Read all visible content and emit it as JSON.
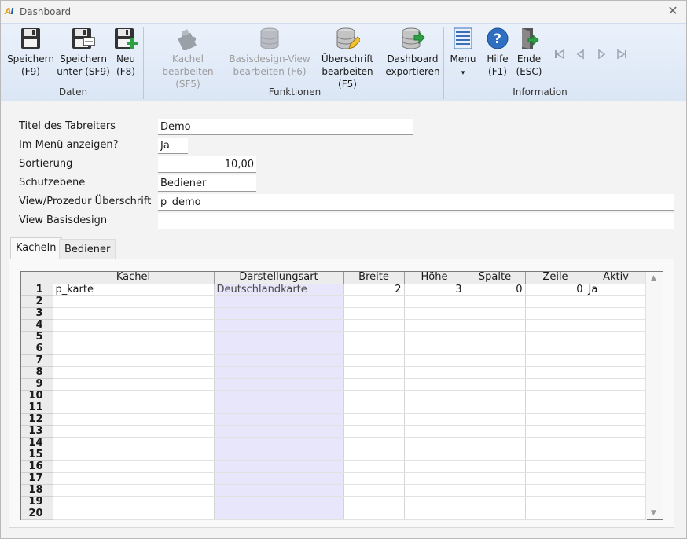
{
  "window": {
    "title": "Dashboard",
    "logo_a": "A",
    "logo_i": "I"
  },
  "ribbon": {
    "groups": [
      {
        "label": "Daten"
      },
      {
        "label": "Funktionen"
      },
      {
        "label": "Information"
      }
    ],
    "buttons": {
      "save": {
        "line1": "Speichern",
        "line2": "(F9)",
        "icon": "floppy-disk-icon"
      },
      "save_as": {
        "line1": "Speichern",
        "line2": "unter (SF9)",
        "icon": "floppy-save-as-icon"
      },
      "new": {
        "line1": "Neu",
        "line2": "(F8)",
        "icon": "floppy-new-icon"
      },
      "edit_tile": {
        "line1": "Kachel",
        "line2": "bearbeiten (SF5)",
        "icon": "puzzle-icon"
      },
      "edit_base_view": {
        "line1": "Basisdesign-View",
        "line2": "bearbeiten (F6)",
        "icon": "database-icon"
      },
      "edit_heading": {
        "line1": "Überschrift",
        "line2": "bearbeiten (F5)",
        "icon": "database-edit-icon"
      },
      "export_dashboard": {
        "line1": "Dashboard",
        "line2": "exportieren",
        "icon": "database-export-icon"
      },
      "menu": {
        "line1": "Menu",
        "line2": "▾",
        "icon": "menu-icon"
      },
      "help": {
        "line1": "Hilfe",
        "line2": "(F1)",
        "icon": "help-icon"
      },
      "exit": {
        "line1": "Ende",
        "line2": "(ESC)",
        "icon": "exit-door-icon"
      }
    },
    "nav_icons": [
      "first-record-icon",
      "previous-record-icon",
      "next-record-icon",
      "last-record-icon"
    ]
  },
  "form": {
    "tab_title": {
      "label": "Titel des Tabreiters",
      "value": "Demo"
    },
    "show_in_menu": {
      "label": "Im Menü anzeigen?",
      "value": "Ja"
    },
    "sort": {
      "label": "Sortierung",
      "value": "10,00"
    },
    "protection": {
      "label": "Schutzebene",
      "value": "Bediener"
    },
    "view_heading": {
      "label": "View/Prozedur Überschrift",
      "value": "p_demo"
    },
    "view_base": {
      "label": "View Basisdesign",
      "value": ""
    }
  },
  "tabs": [
    {
      "label": "Kacheln",
      "active": true
    },
    {
      "label": "Bediener",
      "active": false
    }
  ],
  "grid": {
    "columns": [
      "Kachel",
      "Darstellungsart",
      "Breite",
      "Höhe",
      "Spalte",
      "Zeile",
      "Aktiv"
    ],
    "rows": [
      [
        "1",
        "p_karte",
        "Deutschlandkarte",
        "2",
        "3",
        "0",
        "0",
        "Ja"
      ],
      [
        "2",
        "",
        "",
        "",
        "",
        "",
        "",
        ""
      ],
      [
        "3",
        "",
        "",
        "",
        "",
        "",
        "",
        ""
      ],
      [
        "4",
        "",
        "",
        "",
        "",
        "",
        "",
        ""
      ],
      [
        "5",
        "",
        "",
        "",
        "",
        "",
        "",
        ""
      ],
      [
        "6",
        "",
        "",
        "",
        "",
        "",
        "",
        ""
      ],
      [
        "7",
        "",
        "",
        "",
        "",
        "",
        "",
        ""
      ],
      [
        "8",
        "",
        "",
        "",
        "",
        "",
        "",
        ""
      ],
      [
        "9",
        "",
        "",
        "",
        "",
        "",
        "",
        ""
      ],
      [
        "10",
        "",
        "",
        "",
        "",
        "",
        "",
        ""
      ],
      [
        "11",
        "",
        "",
        "",
        "",
        "",
        "",
        ""
      ],
      [
        "12",
        "",
        "",
        "",
        "",
        "",
        "",
        ""
      ],
      [
        "13",
        "",
        "",
        "",
        "",
        "",
        "",
        ""
      ],
      [
        "14",
        "",
        "",
        "",
        "",
        "",
        "",
        ""
      ],
      [
        "15",
        "",
        "",
        "",
        "",
        "",
        "",
        ""
      ],
      [
        "16",
        "",
        "",
        "",
        "",
        "",
        "",
        ""
      ],
      [
        "17",
        "",
        "",
        "",
        "",
        "",
        "",
        ""
      ],
      [
        "18",
        "",
        "",
        "",
        "",
        "",
        "",
        ""
      ],
      [
        "19",
        "",
        "",
        "",
        "",
        "",
        "",
        ""
      ],
      [
        "20",
        "",
        "",
        "",
        "",
        "",
        "",
        ""
      ]
    ]
  }
}
